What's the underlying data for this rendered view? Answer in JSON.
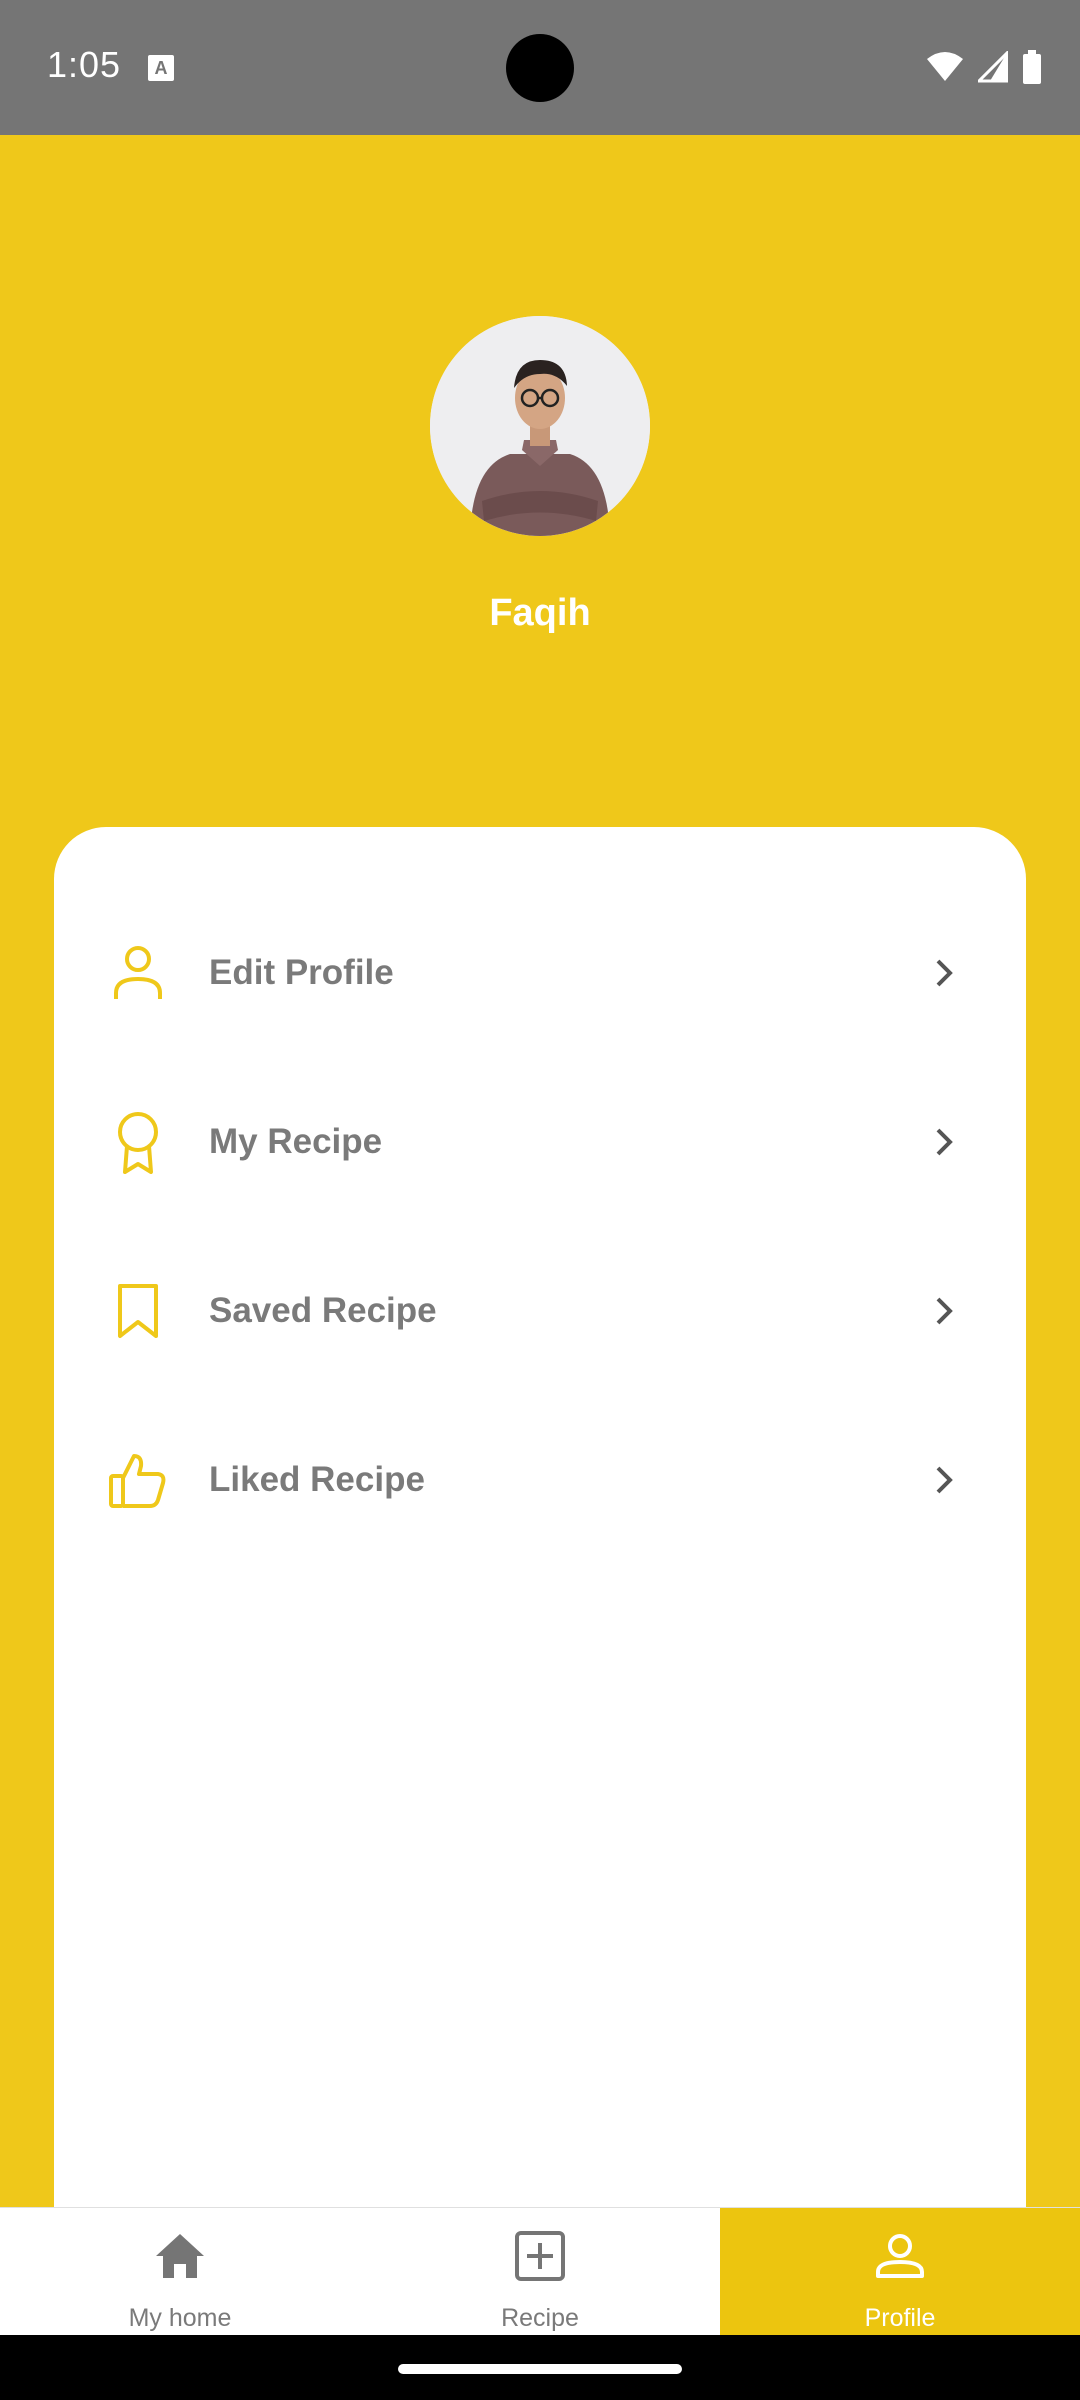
{
  "status_bar": {
    "time": "1:05",
    "notification_glyph": "A"
  },
  "profile": {
    "name": "Faqih",
    "avatar": "profile-photo"
  },
  "menu": [
    {
      "label": "Edit Profile",
      "icon": "person-icon"
    },
    {
      "label": "My Recipe",
      "icon": "award-icon"
    },
    {
      "label": "Saved Recipe",
      "icon": "bookmark-icon"
    },
    {
      "label": "Liked Recipe",
      "icon": "thumbs-up-icon"
    }
  ],
  "bottom_nav": [
    {
      "label": "My home",
      "icon": "home-icon",
      "active": false
    },
    {
      "label": "Recipe",
      "icon": "add-box-icon",
      "active": false
    },
    {
      "label": "Profile",
      "icon": "person-icon",
      "active": true
    }
  ],
  "colors": {
    "accent": "#EFC81A",
    "label": "#7A7A7A",
    "nav_active": "#ECC50F"
  }
}
